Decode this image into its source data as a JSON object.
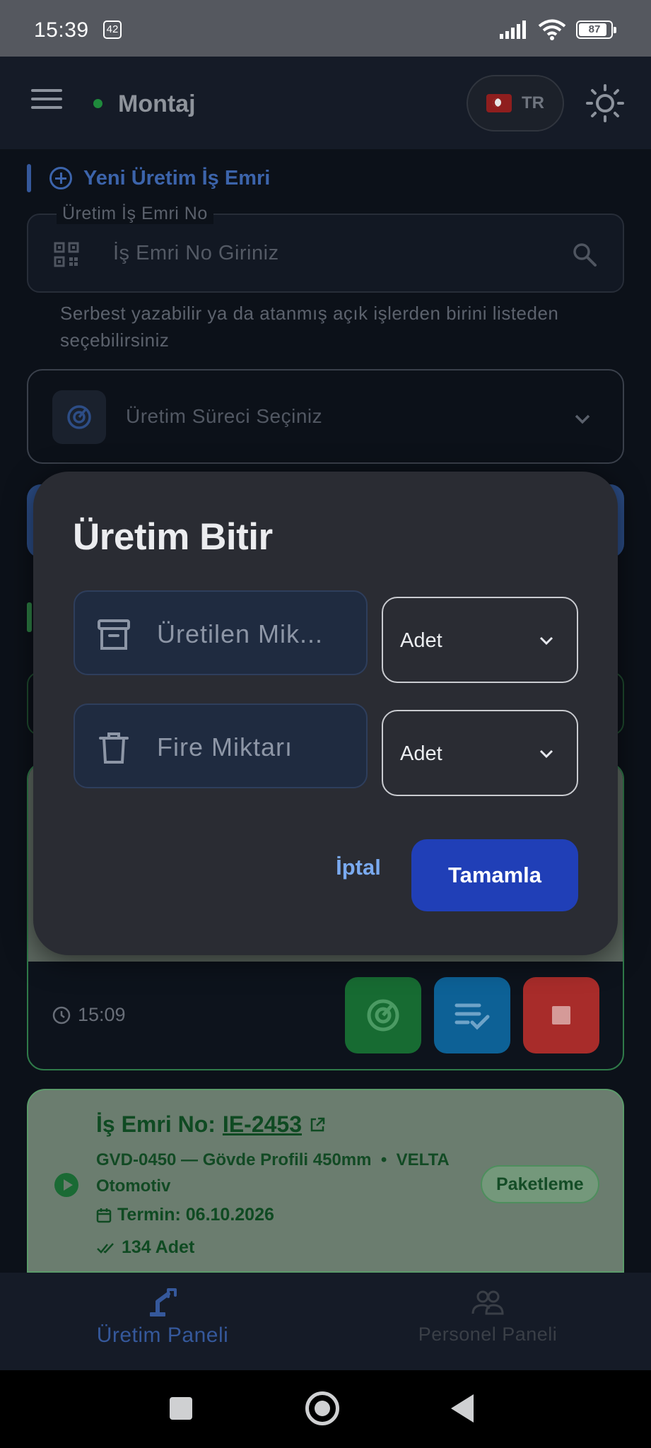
{
  "status_bar": {
    "time": "15:39",
    "notification_count": "42",
    "battery": "87"
  },
  "header": {
    "title": "Montaj",
    "language": "TR"
  },
  "new_order": {
    "section_title": "Yeni Üretim İş Emri",
    "field_label": "Üretim İş Emri No",
    "field_placeholder": "İş Emri No Giriniz",
    "helper_text": "Serbest yazabilir ya da atanmış açık işlerden birini listeden seçebilirsiniz",
    "process_placeholder": "Üretim Süreci Seçiniz"
  },
  "active_card": {
    "time": "15:09"
  },
  "order_card": {
    "label": "İş Emri No:",
    "order_no": "IE-2453",
    "product": "GVD-0450 — Gövde Profili 450mm",
    "separator": "•",
    "customer": "VELTA Otomotiv",
    "deadline": "Termin: 06.10.2026",
    "quantity": "134 Adet",
    "stage": "Paketleme"
  },
  "bottom_nav": {
    "production_label": "Üretim Paneli",
    "personnel_label": "Personel Paneli"
  },
  "dialog": {
    "title": "Üretim Bitir",
    "produced_placeholder": "Üretilen Mik...",
    "scrap_placeholder": "Fire Miktarı",
    "produced_unit": "Adet",
    "scrap_unit": "Adet",
    "cancel_label": "İptal",
    "complete_label": "Tamamla"
  },
  "colors": {
    "accent": "#3c64ab",
    "dialog_bg": "#2a2c33",
    "primary_button": "#203fb7",
    "success": "#176b32",
    "info": "#0d6196",
    "danger": "#a82c2a"
  }
}
